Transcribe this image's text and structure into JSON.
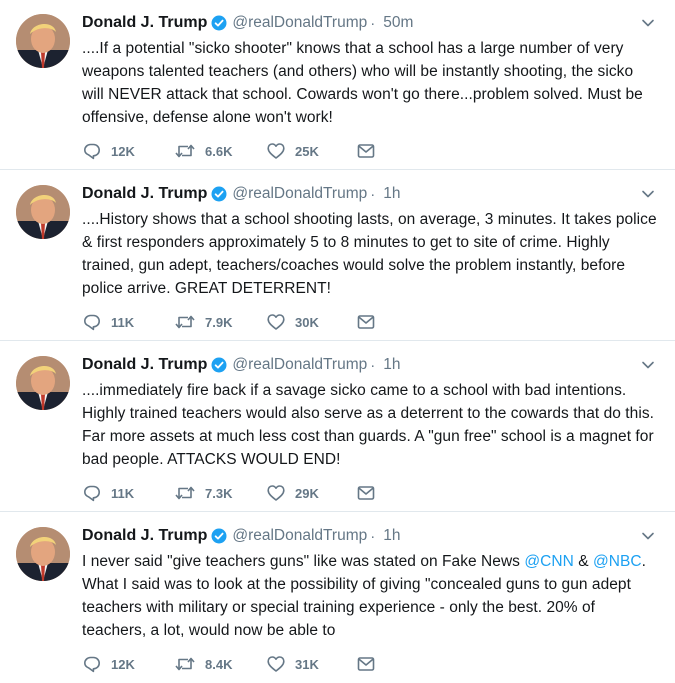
{
  "colors": {
    "accent": "#1da1f2",
    "name_text": "#14171a",
    "secondary_text": "#657786",
    "divider": "#e1e8ed"
  },
  "icons": {
    "verified": "verified-badge-icon",
    "caret": "chevron-down-icon",
    "reply": "reply-icon",
    "retweet": "retweet-icon",
    "like": "heart-icon",
    "dm": "envelope-icon"
  },
  "tweets": [
    {
      "name": "Donald J. Trump",
      "handle": "@realDonaldTrump",
      "separator": "·",
      "time": "50m",
      "text": "....If a potential \"sicko shooter\" knows that a school has a large number of very weapons talented teachers (and others) who will be instantly shooting, the sicko will NEVER attack that school. Cowards won't go there...problem solved. Must be offensive, defense alone won't work!",
      "replies": "12K",
      "retweets": "6.6K",
      "likes": "25K"
    },
    {
      "name": "Donald J. Trump",
      "handle": "@realDonaldTrump",
      "separator": "·",
      "time": "1h",
      "text": "....History shows that a school shooting lasts, on average, 3 minutes. It takes police & first responders approximately 5 to 8 minutes to get to site of crime. Highly trained, gun adept, teachers/coaches would solve the problem instantly, before police arrive. GREAT DETERRENT!",
      "replies": "11K",
      "retweets": "7.9K",
      "likes": "30K"
    },
    {
      "name": "Donald J. Trump",
      "handle": "@realDonaldTrump",
      "separator": "·",
      "time": "1h",
      "text": "....immediately fire back if a savage sicko came to a school with bad intentions. Highly trained teachers would also serve as a deterrent to the cowards that do this. Far more assets at much less cost than guards. A \"gun free\" school is a magnet for bad people. ATTACKS WOULD END!",
      "replies": "11K",
      "retweets": "7.3K",
      "likes": "29K"
    },
    {
      "name": "Donald J. Trump",
      "handle": "@realDonaldTrump",
      "separator": "·",
      "time": "1h",
      "text_before": "I never said \"give teachers guns\" like was stated on Fake News ",
      "mention_1": "@CNN",
      "text_amp": " & ",
      "mention_2": "@NBC",
      "text_after": ". What I said was to look at the possibility of giving \"concealed guns to gun adept teachers with military or special training experience - only the best. 20% of teachers, a lot, would now be able to",
      "replies": "12K",
      "retweets": "8.4K",
      "likes": "31K"
    }
  ]
}
